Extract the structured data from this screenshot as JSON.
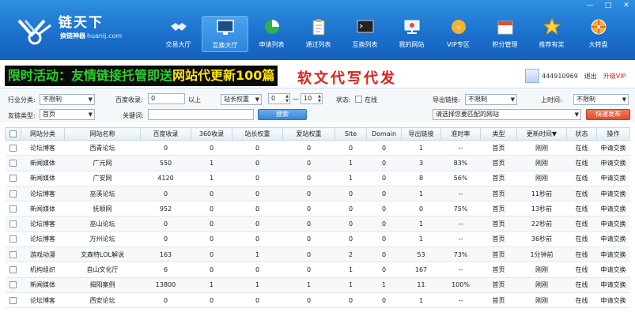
{
  "window": {
    "min": "—",
    "max": "□",
    "close": "✕"
  },
  "app": {
    "title": "链天下",
    "sub_bold": "换链神器",
    "sub_url": "huanlj.com"
  },
  "nav": [
    {
      "label": "交易大厅"
    },
    {
      "label": "互换大厅"
    },
    {
      "label": "申请列表"
    },
    {
      "label": "通过列表"
    },
    {
      "label": "互换列表"
    },
    {
      "label": "我的网站"
    },
    {
      "label": "VIP专区"
    },
    {
      "label": "积分管理"
    },
    {
      "label": "推荐有奖"
    },
    {
      "label": "大转盘"
    }
  ],
  "promo": {
    "part1": "限时活动：友情链接托管即送",
    "part2": "网站代更新100篇",
    "part3": "软文代写代发"
  },
  "user": {
    "qq": "444910969",
    "logout": "退出",
    "upgrade": "升级VIP"
  },
  "filters": {
    "industry_label": "行业分类:",
    "industry_value": "不限制",
    "baidu_label": "百度收录:",
    "baidu_value": "0",
    "above": "以上",
    "weight_select": "站长权重",
    "weight_from": "0",
    "weight_to": "10",
    "status_label": "状态:",
    "online": "在线",
    "export_label": "导出链接:",
    "export_value": "不限制",
    "uptime_label": "上时间:",
    "uptime_value": "不限制",
    "friend_label": "友链类型:",
    "friend_value": "首页",
    "keyword_label": "关键词:",
    "keyword_value": "",
    "search_button": "搜索",
    "site_select": "请选择您要匹配的网站",
    "publish_button": "快速发布"
  },
  "columns": [
    "",
    "网站分类",
    "网站名称",
    "百度收录",
    "360收录",
    "站长权重",
    "爱站权重",
    "Site",
    "Domain",
    "导出链接",
    "准时率",
    "类型",
    "更新时间▼",
    "状态",
    "操作"
  ],
  "rows": [
    [
      "论坛博客",
      "西青论坛",
      "0",
      "0",
      "0",
      "0",
      "0",
      "0",
      "1",
      "--",
      "首页",
      "刚刚",
      "在线",
      "申请交换"
    ],
    [
      "新闻媒体",
      "广元网",
      "550",
      "1",
      "0",
      "0",
      "1",
      "0",
      "3",
      "83%",
      "首页",
      "刚刚",
      "在线",
      "申请交换"
    ],
    [
      "新闻媒体",
      "广安网",
      "4120",
      "1",
      "0",
      "0",
      "1",
      "0",
      "8",
      "56%",
      "首页",
      "刚刚",
      "在线",
      "申请交换"
    ],
    [
      "论坛博客",
      "巫溪论坛",
      "0",
      "0",
      "0",
      "0",
      "0",
      "0",
      "1",
      "--",
      "首页",
      "11秒前",
      "在线",
      "申请交换"
    ],
    [
      "新闻媒体",
      "抚顺网",
      "952",
      "0",
      "0",
      "0",
      "0",
      "0",
      "0",
      "75%",
      "首页",
      "13秒前",
      "在线",
      "申请交换"
    ],
    [
      "论坛博客",
      "巫山论坛",
      "0",
      "0",
      "0",
      "0",
      "0",
      "0",
      "1",
      "--",
      "首页",
      "22秒前",
      "在线",
      "申请交换"
    ],
    [
      "论坛博客",
      "万州论坛",
      "0",
      "0",
      "0",
      "0",
      "0",
      "0",
      "1",
      "--",
      "首页",
      "36秒前",
      "在线",
      "申请交换"
    ],
    [
      "游戏动漫",
      "文森特LOL解说",
      "163",
      "0",
      "1",
      "0",
      "2",
      "0",
      "53",
      "73%",
      "首页",
      "1分钟前",
      "在线",
      "申请交换"
    ],
    [
      "机构组织",
      "自山文化厅",
      "6",
      "0",
      "0",
      "0",
      "1",
      "0",
      "167",
      "--",
      "首页",
      "刚刚",
      "在线",
      "申请交换"
    ],
    [
      "新闻媒体",
      "揭阳案例",
      "13800",
      "1",
      "1",
      "1",
      "1",
      "1",
      "11",
      "100%",
      "首页",
      "刚刚",
      "在线",
      "申请交换"
    ],
    [
      "论坛博客",
      "西安论坛",
      "0",
      "0",
      "0",
      "0",
      "0",
      "0",
      "1",
      "--",
      "首页",
      "刚刚",
      "在线",
      "申请交换"
    ]
  ]
}
